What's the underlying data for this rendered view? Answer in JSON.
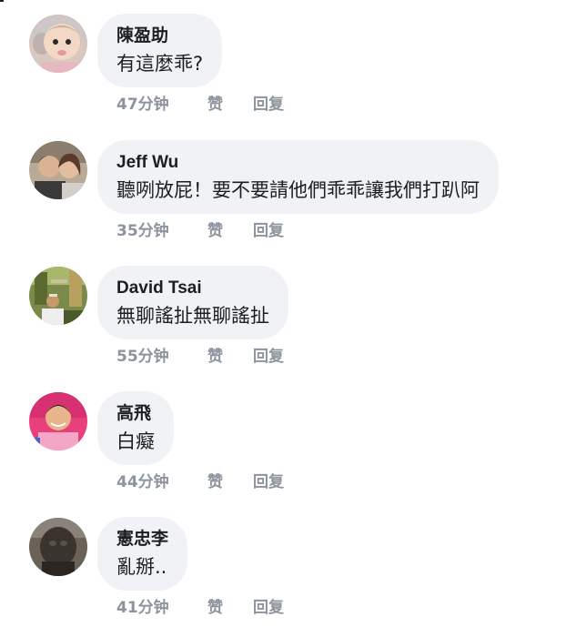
{
  "comments": [
    {
      "author": "陳盈助",
      "text": "有這麼乖?",
      "time": "47分钟",
      "like": "赞",
      "reply": "回复",
      "avatar_icon": "baby-photo-avatar"
    },
    {
      "author": "Jeff Wu",
      "text": "聽咧放屁！要不要請他們乖乖讓我們打趴阿",
      "time": "35分钟",
      "like": "赞",
      "reply": "回复",
      "avatar_icon": "couple-photo-avatar"
    },
    {
      "author": "David Tsai",
      "text": "無聊謠扯無聊謠扯",
      "time": "55分钟",
      "like": "赞",
      "reply": "回复",
      "avatar_icon": "outdoor-man-photo-avatar"
    },
    {
      "author": "高飛",
      "text": "白癡",
      "time": "44分钟",
      "like": "赞",
      "reply": "回复",
      "avatar_icon": "pink-shirt-man-photo-avatar"
    },
    {
      "author": "憲忠李",
      "text": "亂掰..",
      "time": "41分钟",
      "like": "赞",
      "reply": "回复",
      "avatar_icon": "dark-statue-photo-avatar"
    }
  ],
  "colors": {
    "bubble_bg": "#f0f2f5",
    "text": "#1c1e21",
    "meta": "#8d949e"
  }
}
